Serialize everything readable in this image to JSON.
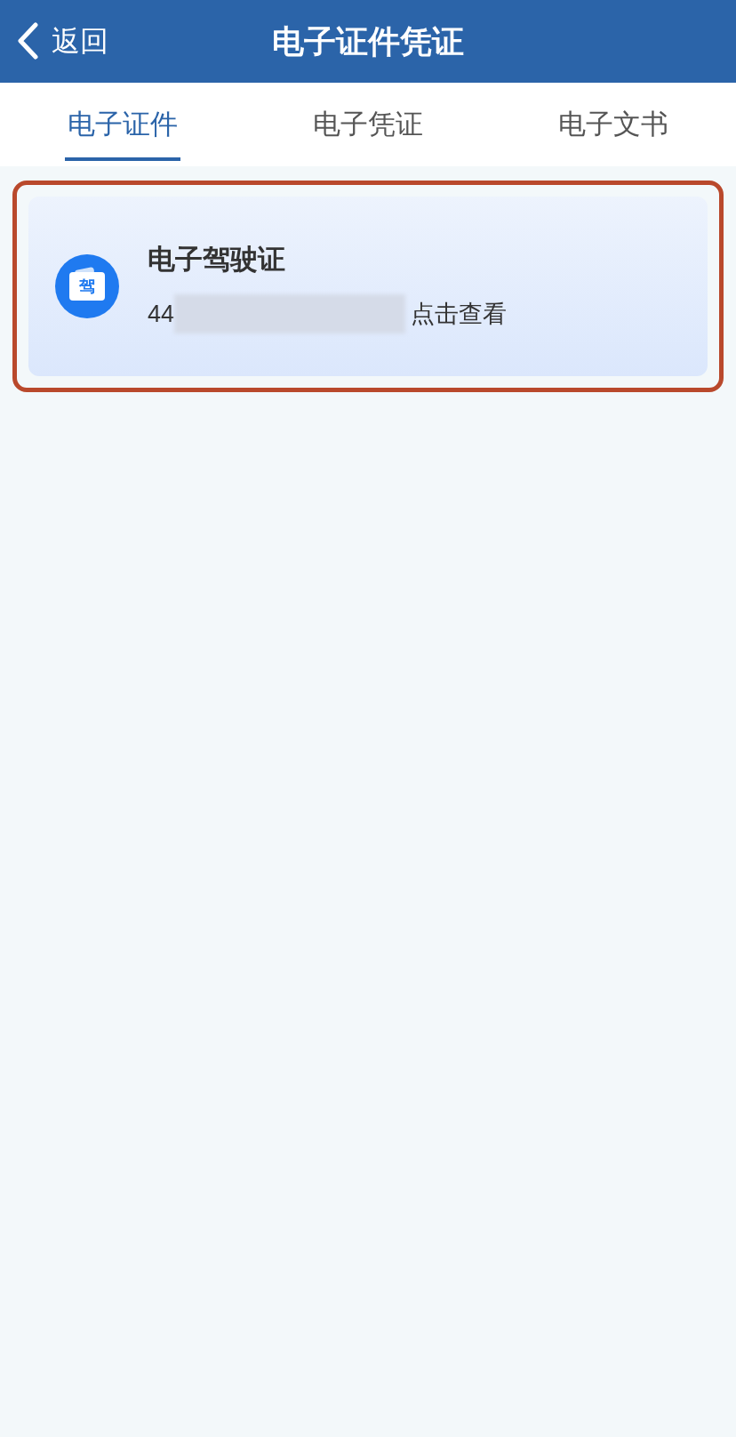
{
  "header": {
    "back_label": "返回",
    "title": "电子证件凭证"
  },
  "tabs": [
    {
      "label": "电子证件",
      "selected": true
    },
    {
      "label": "电子凭证",
      "selected": false
    },
    {
      "label": "电子文书",
      "selected": false
    }
  ],
  "cards": [
    {
      "icon_label": "驾",
      "title": "电子驾驶证",
      "number_prefix": "44",
      "redacted": true,
      "action": "点击查看",
      "highlighted": true
    }
  ]
}
